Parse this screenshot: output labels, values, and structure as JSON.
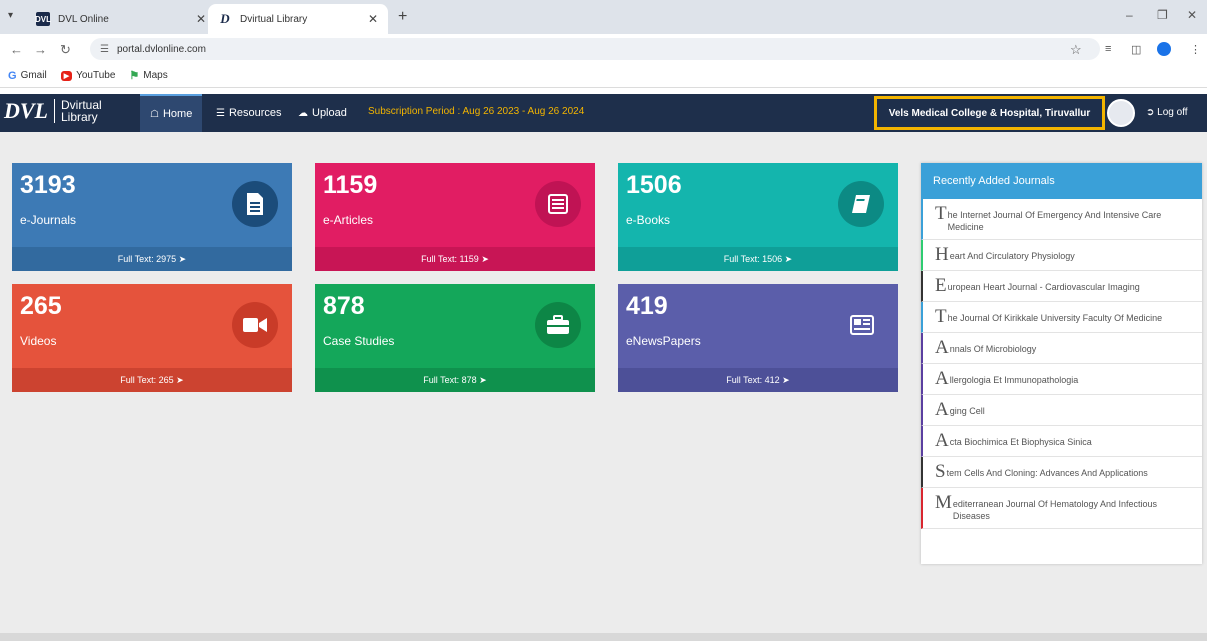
{
  "browser": {
    "tabs": [
      {
        "label": "DVL Online",
        "favicon": "DVL"
      },
      {
        "label": "Dvirtual Library",
        "favicon": "D"
      }
    ],
    "url": "portal.dvlonline.com",
    "bookmarks": [
      {
        "label": "Gmail",
        "icon": "google-icon"
      },
      {
        "label": "YouTube",
        "icon": "youtube-icon"
      },
      {
        "label": "Maps",
        "icon": "maps-icon"
      }
    ]
  },
  "navbar": {
    "logo_mark": "DVL",
    "logo_text_1": "Dvirtual",
    "logo_text_2": "Library",
    "home": "Home",
    "resources": "Resources",
    "upload": "Upload",
    "subscription": "Subscription Period : Aug 26 2023 - Aug 26 2024",
    "institution": "Vels Medical College & Hospital, Tiruvallur",
    "logoff": "Log off",
    "accent_color": "#f2b400",
    "bar_color": "#1e2f4b"
  },
  "stats": [
    {
      "count": "3193",
      "label": "e-Journals",
      "full_text": "Full Text: 2975",
      "icon": "document-icon",
      "color": "#3d7ab5"
    },
    {
      "count": "1159",
      "label": "e-Articles",
      "full_text": "Full Text: 1159",
      "icon": "article-icon",
      "color": "#e11d63"
    },
    {
      "count": "1506",
      "label": "e-Books",
      "full_text": "Full Text: 1506",
      "icon": "book-icon",
      "color": "#14b5ad"
    },
    {
      "count": "265",
      "label": "Videos",
      "full_text": "Full Text: 265",
      "icon": "video-camera-icon",
      "color": "#e5533c"
    },
    {
      "count": "878",
      "label": "Case Studies",
      "full_text": "Full Text: 878",
      "icon": "briefcase-icon",
      "color": "#14a75a"
    },
    {
      "count": "419",
      "label": "eNewsPapers",
      "full_text": "Full Text: 412",
      "icon": "newspaper-icon",
      "color": "#5b5eaa"
    }
  ],
  "journals": {
    "heading": "Recently Added Journals",
    "items": [
      {
        "cap": "T",
        "rest": "he Internet Journal Of Emergency And Intensive Care Medicine",
        "color": "#3aa0d8"
      },
      {
        "cap": "H",
        "rest": "eart And Circulatory Physiology",
        "color": "#2ecc71"
      },
      {
        "cap": "E",
        "rest": "uropean Heart Journal - Cardiovascular Imaging",
        "color": "#333333"
      },
      {
        "cap": "T",
        "rest": "he Journal Of Kirikkale University Faculty Of Medicine",
        "color": "#3aa0d8"
      },
      {
        "cap": "A",
        "rest": "nnals Of Microbiology",
        "color": "#5b3fa0"
      },
      {
        "cap": "A",
        "rest": "llergologia Et Immunopathologia",
        "color": "#5b3fa0"
      },
      {
        "cap": "A",
        "rest": "ging Cell",
        "color": "#5b3fa0"
      },
      {
        "cap": "A",
        "rest": "cta Biochimica Et Biophysica Sinica",
        "color": "#5b3fa0"
      },
      {
        "cap": "S",
        "rest": "tem Cells And Cloning: Advances And Applications",
        "color": "#333333"
      },
      {
        "cap": "M",
        "rest": "editerranean Journal Of Hematology And Infectious Diseases",
        "color": "#d9262f"
      }
    ]
  }
}
